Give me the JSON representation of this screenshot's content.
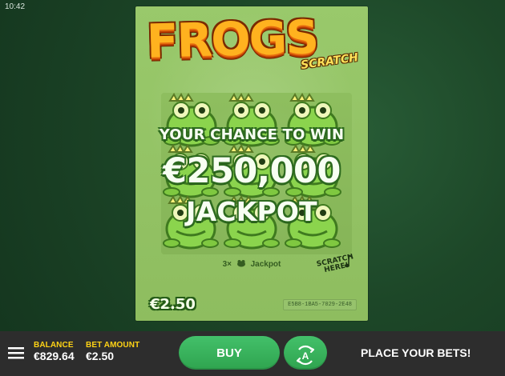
{
  "status_bar": {
    "time": "10:42"
  },
  "ticket": {
    "logo_main": "FROGS",
    "logo_sub": "SCRATCH",
    "promo_line_1": "YOUR CHANCE TO WIN",
    "promo_amount": "€250,000",
    "promo_line_2": "JACKPOT",
    "jackpot_rule_prefix": "3×",
    "jackpot_rule_suffix": "Jackpot",
    "scratch_here_line_1": "SCRATCH",
    "scratch_here_line_2": "HERE!",
    "price": "€2.50",
    "ticket_id": "E5B8-1BA5-7029-2E48"
  },
  "bottom_bar": {
    "balance_label": "BALANCE",
    "balance_value": "€829.64",
    "bet_label": "BET AMOUNT",
    "bet_value": "€2.50",
    "buy_label": "BUY",
    "autoplay_glyph": "A",
    "status_message": "PLACE YOUR BETS!",
    "menu_icon": "menu-icon",
    "autoplay_icon": "autoplay-icon"
  },
  "colors": {
    "bar_bg": "#2d2d2d",
    "accent_green": "#35ad58",
    "label_yellow": "#ffd315",
    "ticket_green": "#93c364"
  }
}
